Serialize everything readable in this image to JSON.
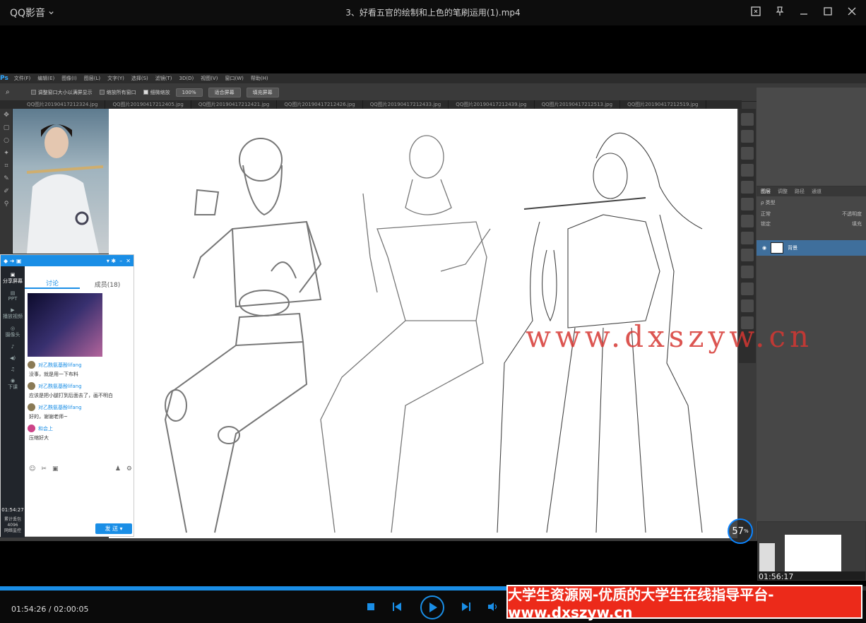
{
  "app": {
    "name": "QQ影音",
    "file_title": "3、好看五官的绘制和上色的笔刷运用(1).mp4"
  },
  "icons": {
    "app_menu": "chevron-down-icon",
    "screenshot": "screenshot-icon",
    "pin": "pin-icon",
    "minimize": "minimize-icon",
    "maximize": "maximize-icon",
    "close": "close-icon"
  },
  "photoshop": {
    "logo": "Ps",
    "menu": [
      "文件(F)",
      "编辑(E)",
      "图像(I)",
      "图层(L)",
      "文字(Y)",
      "选择(S)",
      "滤镜(T)",
      "3D(D)",
      "视图(V)",
      "窗口(W)",
      "帮助(H)"
    ],
    "options": {
      "resize_windows": "调整窗口大小以满屏显示",
      "zoom_all": "缩放所有窗口",
      "scrubby": "细微缩放",
      "zoom_value": "100%",
      "fit_screen": "适合屏幕",
      "fill_screen": "填充屏幕"
    },
    "tabs": [
      "QQ图片20190417212324.jpg",
      "QQ图片20190417212405.jpg",
      "QQ图片20190417212421.jpg",
      "QQ图片20190417212426.jpg",
      "QQ图片20190417212433.jpg",
      "QQ图片20190417212439.jpg",
      "QQ图片20190417212513.jpg",
      "QQ图片20190417212519.jpg"
    ],
    "layers": {
      "tabs": [
        "图层",
        "通道",
        "路径",
        "调整"
      ],
      "kind": "类型",
      "blend": "正常",
      "opacity_label": "不透明度",
      "lock_label": "锁定",
      "fill_label": "填充",
      "layer_name": "背景"
    }
  },
  "chat": {
    "tabs": [
      "讨论",
      "成员(18)"
    ],
    "side_items": [
      "分享屏幕",
      "PPT",
      "播放视频",
      "摄像头"
    ],
    "side_quit": "下课",
    "side_time": "01:54:27",
    "side_stats": [
      "累计丢包",
      "4096",
      "网络监控"
    ],
    "messages": [
      {
        "user": "对乙酰氨基酚lifang",
        "text": "没事，就是用一下布料"
      },
      {
        "user": "对乙酰氨基酚lifang",
        "text": "应该是把小腿打到后面去了，画不明白"
      },
      {
        "user": "对乙酰氨基酚lifang",
        "text": "好的，谢谢老师~"
      },
      {
        "user": "和会上",
        "text": "压缩好大"
      }
    ],
    "send": "发 送"
  },
  "overlay": {
    "watermark": "www.dxszyw.cn",
    "zoom_percent": "57",
    "zoom_unit": "%",
    "thumb_time": "01:56:17"
  },
  "playback": {
    "current": "01:54:26",
    "total": "02:00:05",
    "progress": 0.951
  },
  "banner": "大学生资源网-优质的大学生在线指导平台-www.dxszyw.cn",
  "colors": {
    "accent": "#1a8ee6",
    "banner": "#ec2a1a",
    "watermark": "#d63732"
  }
}
